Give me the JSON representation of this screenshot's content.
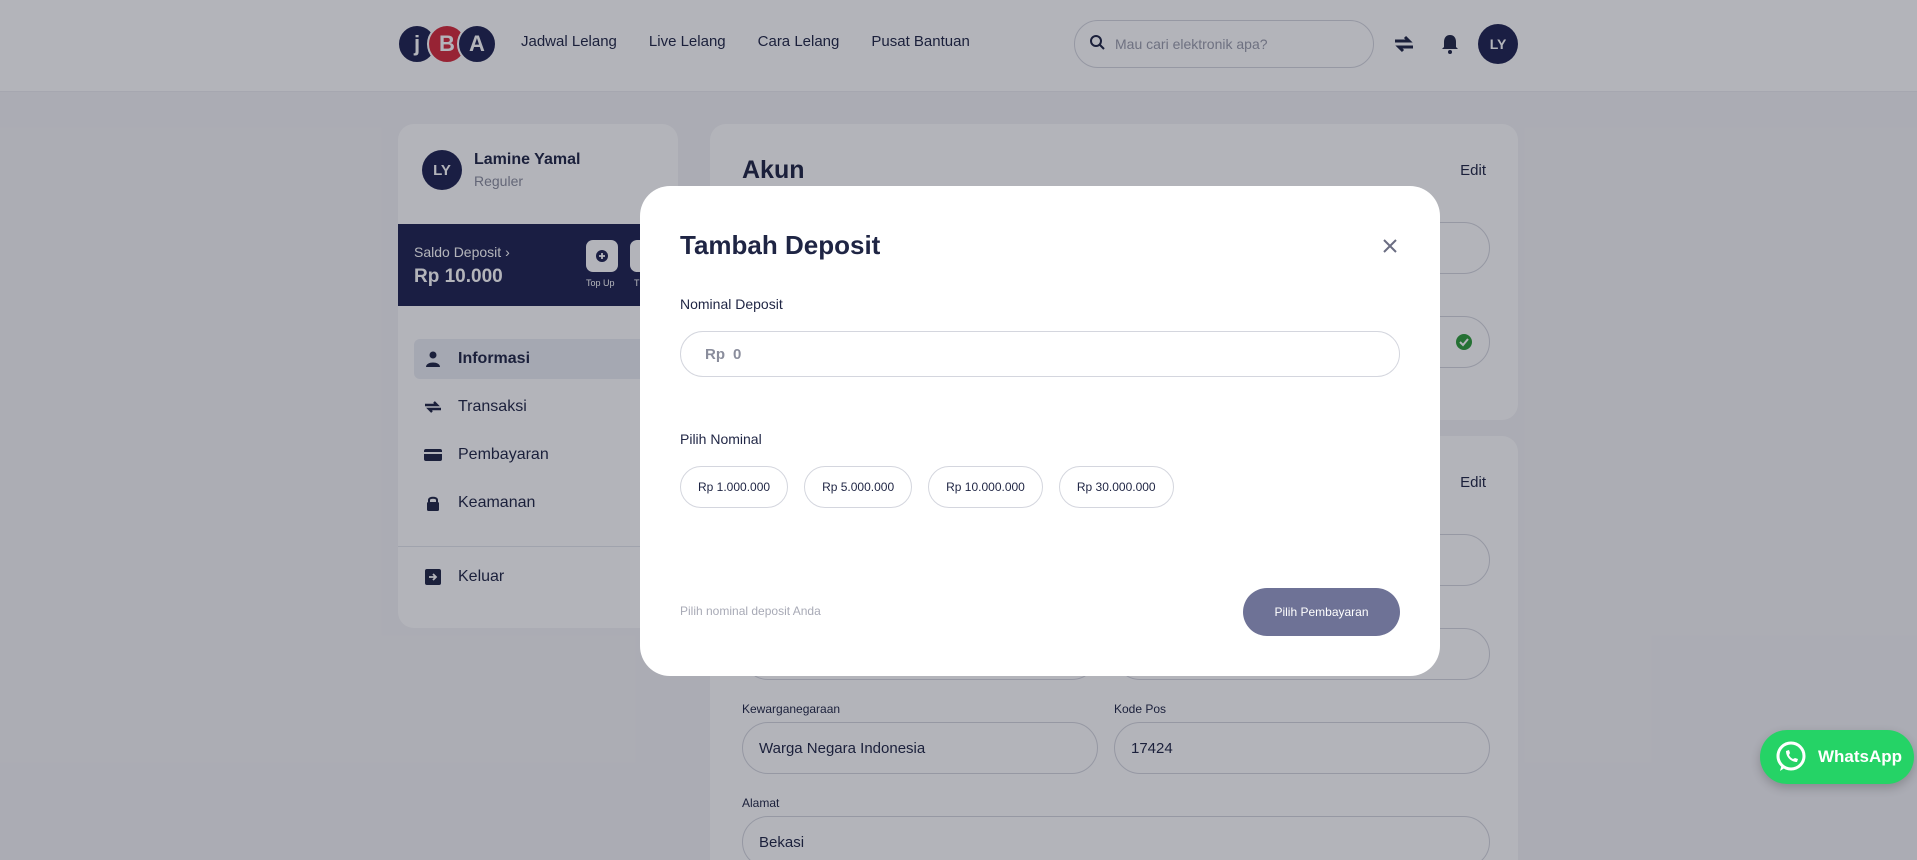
{
  "header": {
    "logo_letters": [
      "j",
      "B",
      "A"
    ],
    "nav": [
      "Jadwal Lelang",
      "Live Lelang",
      "Cara Lelang",
      "Pusat Bantuan"
    ],
    "search_placeholder": "Mau cari elektronik apa?",
    "avatar_initials": "LY",
    "icons": [
      "search-icon",
      "transfer-icon",
      "bell-icon"
    ]
  },
  "sidebar": {
    "avatar_initials": "LY",
    "user_name": "Lamine Yamal",
    "user_tier": "Reguler",
    "deposit_label": "Saldo Deposit",
    "deposit_value": "Rp 10.000",
    "topup_label": "Top Up",
    "second_label": "T",
    "menu": [
      {
        "label": "Informasi",
        "icon": "user-icon",
        "active": true
      },
      {
        "label": "Transaksi",
        "icon": "transfer-icon",
        "active": false
      },
      {
        "label": "Pembayaran",
        "icon": "card-icon",
        "active": false
      },
      {
        "label": "Keamanan",
        "icon": "lock-icon",
        "active": false
      }
    ],
    "logout_label": "Keluar"
  },
  "account": {
    "title": "Akun",
    "edit_label": "Edit"
  },
  "address": {
    "edit_label": "Edit",
    "nationality_label": "Kewarganegaraan",
    "nationality_value": "Warga Negara Indonesia",
    "postal_label": "Kode Pos",
    "postal_value": "17424",
    "address_label": "Alamat",
    "address_value": "Bekasi"
  },
  "modal": {
    "title": "Tambah Deposit",
    "nominal_label": "Nominal Deposit",
    "currency_prefix": "Rp",
    "nominal_value": "0",
    "choose_label": "Pilih Nominal",
    "options": [
      "Rp 1.000.000",
      "Rp 5.000.000",
      "Rp 10.000.000",
      "Rp 30.000.000"
    ],
    "hint": "Pilih nominal deposit Anda",
    "pay_button": "Pilih Pembayaran"
  },
  "whatsapp_label": "WhatsApp",
  "colors": {
    "primary": "#1e2350",
    "accent_red": "#d62a3a",
    "button_disabled": "#6e7296",
    "whatsapp": "#25d366",
    "verified": "#2e9c3a"
  }
}
